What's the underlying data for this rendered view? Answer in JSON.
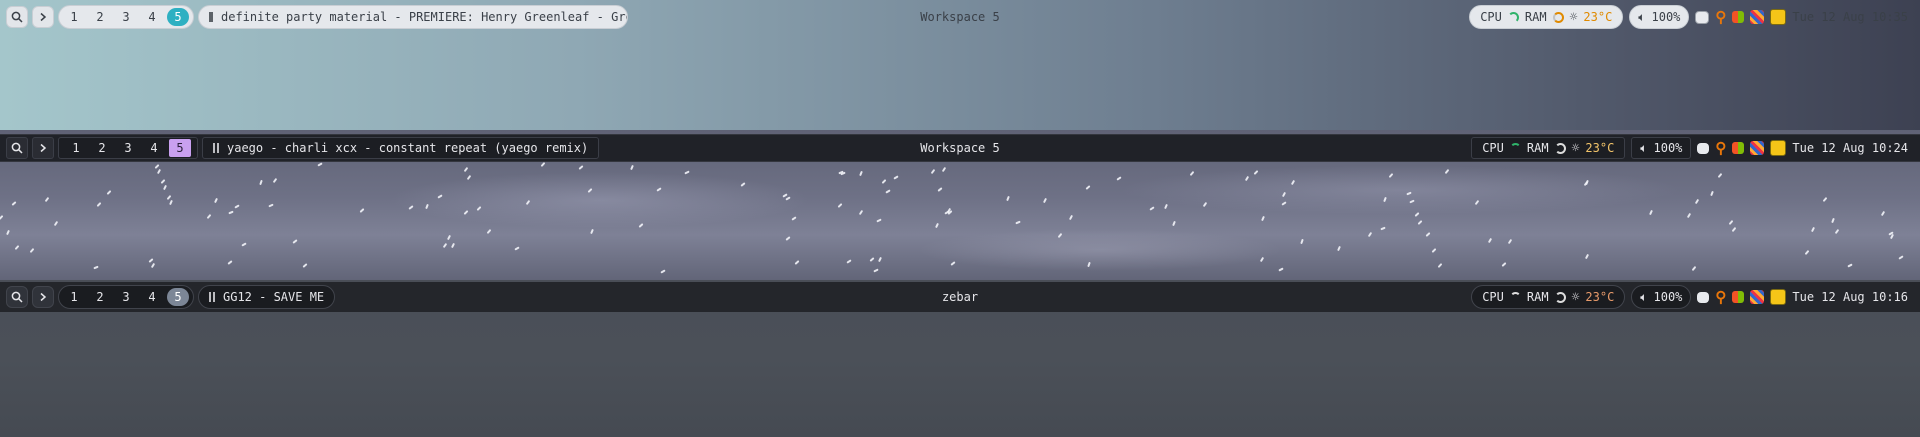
{
  "bars": [
    {
      "id": "bar1",
      "search_icon": "search-icon",
      "next_icon": "chevron-right-icon",
      "workspaces": [
        "1",
        "2",
        "3",
        "4",
        "5"
      ],
      "active_workspace": "5",
      "now_playing": "definite party material - PREMIERE: Henry Greenleaf - Group …",
      "center_label": "Workspace 5",
      "cpu_label": "CPU",
      "ram_label": "RAM",
      "temperature": "23°C",
      "volume": "100%",
      "datetime": "Tue 12 Aug 10:35"
    },
    {
      "id": "bar2",
      "search_icon": "search-icon",
      "next_icon": "chevron-right-icon",
      "workspaces": [
        "1",
        "2",
        "3",
        "4",
        "5"
      ],
      "active_workspace": "5",
      "now_playing": "yaego - charli xcx - constant repeat (yaego remix)",
      "center_label": "Workspace 5",
      "cpu_label": "CPU",
      "ram_label": "RAM",
      "temperature": "23°C",
      "volume": "100%",
      "datetime": "Tue 12 Aug 10:24"
    },
    {
      "id": "bar3",
      "search_icon": "search-icon",
      "next_icon": "chevron-right-icon",
      "workspaces": [
        "1",
        "2",
        "3",
        "4",
        "5"
      ],
      "active_workspace": "5",
      "now_playing": "GG12 - SAVE ME",
      "center_label": "zebar",
      "cpu_label": "CPU",
      "ram_label": "RAM",
      "temperature": "23°C",
      "volume": "100%",
      "datetime": "Tue 12 Aug 10:16"
    }
  ],
  "colors": {
    "bar1_accent": "#2eb0c2",
    "bar2_accent": "#c9a0f0",
    "bar3_accent": "#7c8696",
    "temp_warm": "#e08a00"
  },
  "tray_icons": [
    "discord-icon",
    "search-magnifier-icon",
    "windows-icon",
    "stripes-app-icon",
    "image-viewer-icon"
  ]
}
